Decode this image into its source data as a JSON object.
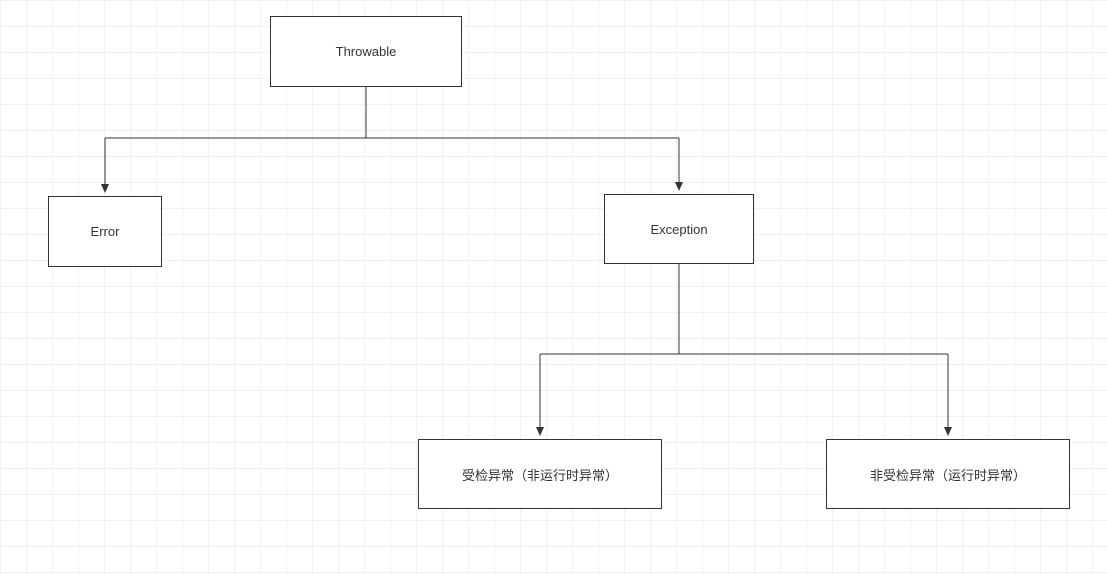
{
  "diagram": {
    "nodes": {
      "throwable": {
        "label": "Throwable"
      },
      "error": {
        "label": "Error"
      },
      "exception": {
        "label": "Exception"
      },
      "checked": {
        "label": "受检异常（非运行时异常）"
      },
      "unchecked": {
        "label": "非受检异常（运行时异常）"
      }
    }
  }
}
